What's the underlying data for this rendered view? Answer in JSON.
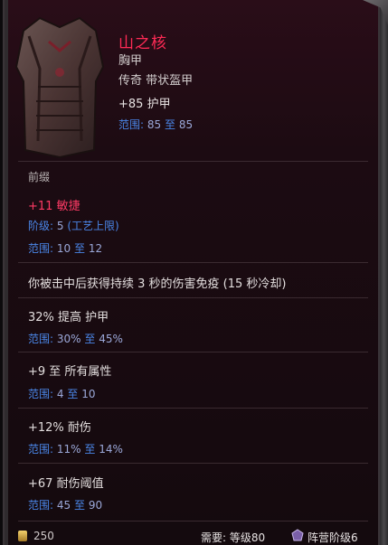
{
  "item": {
    "name": "山之核",
    "slot": "胸甲",
    "rarity_type": "传奇 带状盔甲",
    "armor": "+85 护甲",
    "range_label": "范围:",
    "range_min": "85",
    "range_to": "至",
    "range_max": "85"
  },
  "sections": {
    "prefix": "前缀"
  },
  "affixes": [
    {
      "text": "+11 敏捷",
      "tier_label": "阶级:",
      "tier_value": "5",
      "tier_note": "(工艺上限)",
      "range_label": "范围:",
      "min": "10",
      "to": "至",
      "max": "12"
    },
    {
      "text": "你被击中后获得持续 3 秒的伤害免疫 (15 秒冷却)"
    },
    {
      "text": "32% 提高 护甲",
      "range_label": "范围:",
      "min": "30%",
      "to": "至",
      "max": "45%"
    },
    {
      "text": "+9 至 所有属性",
      "range_label": "范围:",
      "min": "4",
      "to": "至",
      "max": "10"
    },
    {
      "text": "+12% 耐伤",
      "range_label": "范围:",
      "min": "11%",
      "to": "至",
      "max": "14%"
    },
    {
      "text": "+67 耐伤阈值",
      "range_label": "范围:",
      "min": "45",
      "to": "至",
      "max": "90"
    }
  ],
  "footer": {
    "gold": "250",
    "requirement": "需要: 等级80",
    "faction": "阵营阶级6"
  },
  "colors": {
    "name": "#ff2a55",
    "range_label": "#4a86e8",
    "background": "#1c0b12"
  }
}
